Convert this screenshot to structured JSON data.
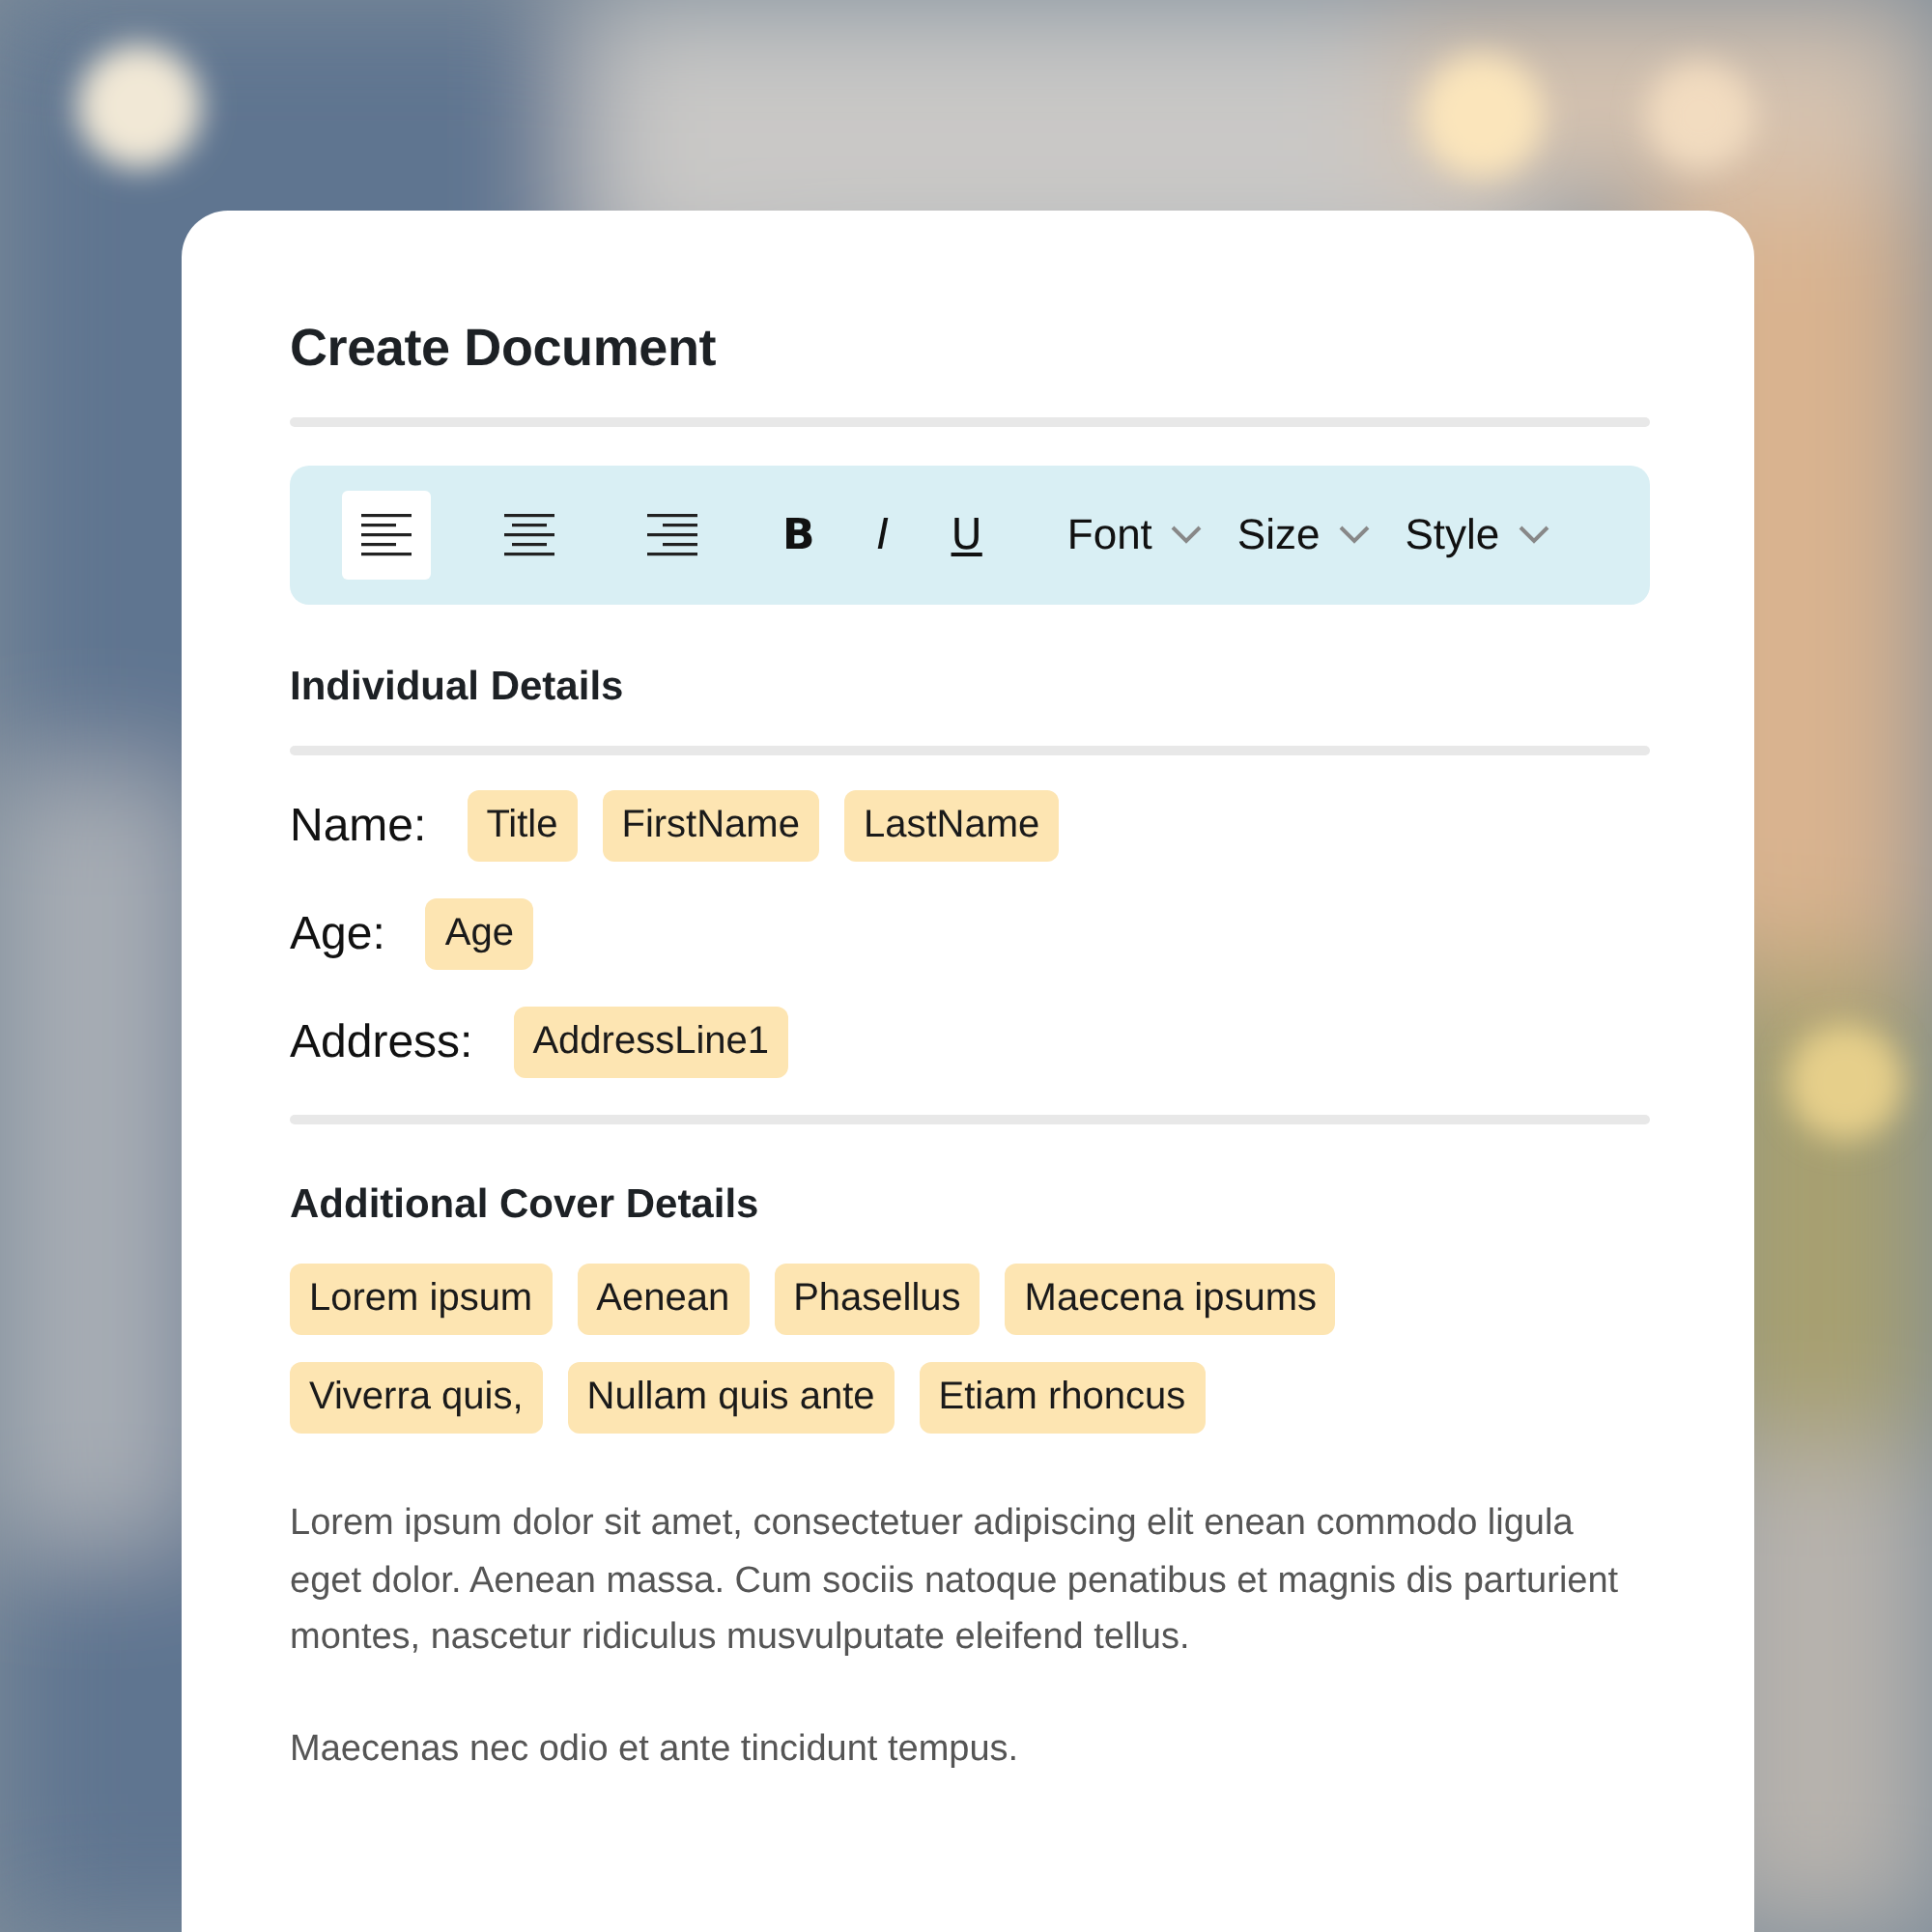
{
  "title": "Create Document",
  "toolbar": {
    "align": [
      {
        "kind": "left",
        "selected": true
      },
      {
        "kind": "center",
        "selected": false
      },
      {
        "kind": "right",
        "selected": false
      }
    ],
    "format": [
      {
        "kind": "bold",
        "label": "B"
      },
      {
        "kind": "italic",
        "label": "I"
      },
      {
        "kind": "underline",
        "label": "U"
      }
    ],
    "dropdowns": [
      "Font",
      "Size",
      "Style"
    ]
  },
  "individual": {
    "heading": "Individual Details",
    "fields": [
      {
        "label": "Name:",
        "tokens": [
          "Title",
          "FirstName",
          "LastName"
        ]
      },
      {
        "label": "Age:",
        "tokens": [
          "Age"
        ]
      },
      {
        "label": "Address:",
        "tokens": [
          "AddressLine1"
        ]
      }
    ]
  },
  "additional": {
    "heading": "Additional Cover Details",
    "tags": [
      "Lorem ipsum",
      "Aenean",
      "Phasellus",
      "Maecena ipsums",
      "Viverra quis,",
      "Nullam quis ante",
      "Etiam rhoncus"
    ]
  },
  "paragraphs": [
    "Lorem ipsum dolor sit amet, consectetuer adipiscing elit enean commodo ligula eget dolor. Aenean massa. Cum sociis natoque penatibus et magnis dis parturient montes, nascetur ridiculus musvulputate eleifend tellus.",
    "Maecenas nec odio et ante tincidunt tempus."
  ]
}
